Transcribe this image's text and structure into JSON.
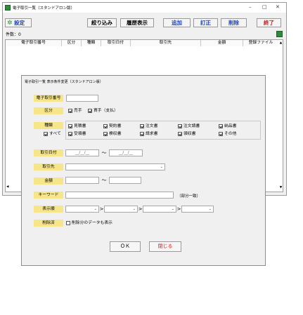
{
  "main_window": {
    "title": "電子取引一覧（スタンドアロン版）",
    "minimize": "–",
    "maximize": "□",
    "close": "✕",
    "toolbar": {
      "settings": "設定",
      "narrow": "絞り込み",
      "history": "履歴表示",
      "add": "追加",
      "correct": "訂正",
      "delete": "削除",
      "exit": "終了"
    },
    "count_label": "件数：0",
    "columns": [
      "電子取引番号",
      "区分",
      "種類",
      "取引日付",
      "取引先",
      "金額",
      "登録ファイル"
    ]
  },
  "dialog": {
    "title": "電子取引一覧 表示条件変更（スタンドアロン版）",
    "fields": {
      "number": {
        "label": "電子取引番号",
        "value": ""
      },
      "category": {
        "label": "区分",
        "options": [
          {
            "text": "売手",
            "checked": true
          },
          {
            "text": "買手（支払）",
            "checked": true
          }
        ]
      },
      "kind": {
        "label": "種類",
        "all": {
          "text": "すべて",
          "checked": true
        },
        "options": [
          {
            "text": "見積書",
            "checked": true
          },
          {
            "text": "契約書",
            "checked": true
          },
          {
            "text": "注文書",
            "checked": true
          },
          {
            "text": "注文請書",
            "checked": true
          },
          {
            "text": "納品書",
            "checked": true
          },
          {
            "text": "受領書",
            "checked": true
          },
          {
            "text": "検収書",
            "checked": true
          },
          {
            "text": "請求書",
            "checked": true
          },
          {
            "text": "領収書",
            "checked": true
          },
          {
            "text": "その他",
            "checked": true
          }
        ]
      },
      "date": {
        "label": "取引日付",
        "from": "__/__/__",
        "to": "__/__/__",
        "separator": "～"
      },
      "partner": {
        "label": "取引先",
        "value": ""
      },
      "amount": {
        "label": "金額",
        "from": "",
        "to": "",
        "separator": "～"
      },
      "keyword": {
        "label": "キーワード",
        "value": "",
        "hint": "（部分一致）"
      },
      "order": {
        "label": "表示順",
        "separator": ">"
      },
      "deleted": {
        "label": "削除済",
        "option": {
          "text": "削除分のデータも表示",
          "checked": false
        }
      }
    },
    "ok": "ＯＫ",
    "close": "閉じる"
  }
}
